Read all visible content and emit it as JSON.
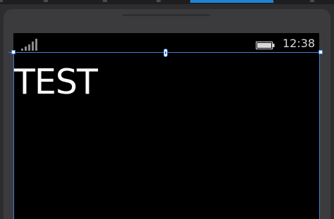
{
  "status_bar": {
    "clock": "12:38",
    "signal_icon": "signal-strength-icon",
    "battery_icon": "battery-icon"
  },
  "page": {
    "title": "TEST"
  },
  "colors": {
    "screen_background": "#000000",
    "title_text": "#ffffff",
    "selection_accent": "#3d7fd6",
    "tab_accent": "#1d83d4"
  }
}
